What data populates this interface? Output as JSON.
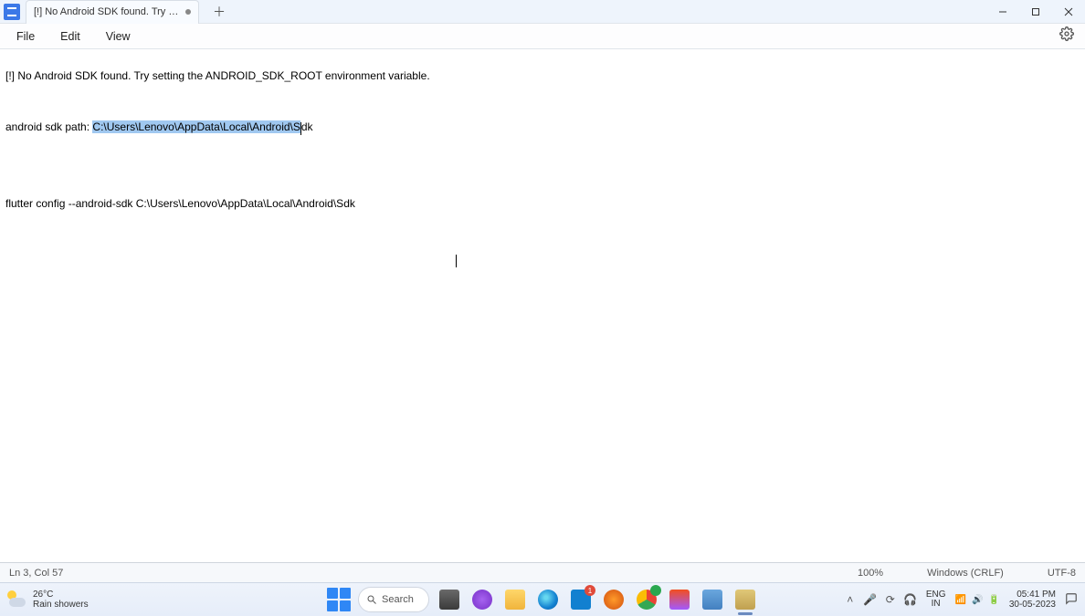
{
  "tab": {
    "title": "[!] No Android SDK found. Try setti"
  },
  "window_controls": {
    "minimize_title": "Minimize",
    "maximize_title": "Maximize",
    "close_title": "Close"
  },
  "menu": {
    "file": "File",
    "edit": "Edit",
    "view": "View"
  },
  "editor": {
    "line1": "[!] No Android SDK found. Try setting the ANDROID_SDK_ROOT environment variable.",
    "line3_prefix": "android sdk path: ",
    "line3_selected": "C:\\Users\\Lenovo\\AppData\\Local\\Android\\S",
    "line3_suffix": "dk",
    "line6": "flutter config --android-sdk C:\\Users\\Lenovo\\AppData\\Local\\Android\\Sdk"
  },
  "status": {
    "position": "Ln 3, Col 57",
    "zoom": "100%",
    "line_ending": "Windows (CRLF)",
    "encoding": "UTF-8"
  },
  "taskbar": {
    "weather_temp": "26°C",
    "weather_desc": "Rain showers",
    "search_placeholder": "Search",
    "store_badge": "1",
    "lang_top": "ENG",
    "lang_bottom": "IN",
    "time": "05:41 PM",
    "date": "30-05-2023"
  }
}
